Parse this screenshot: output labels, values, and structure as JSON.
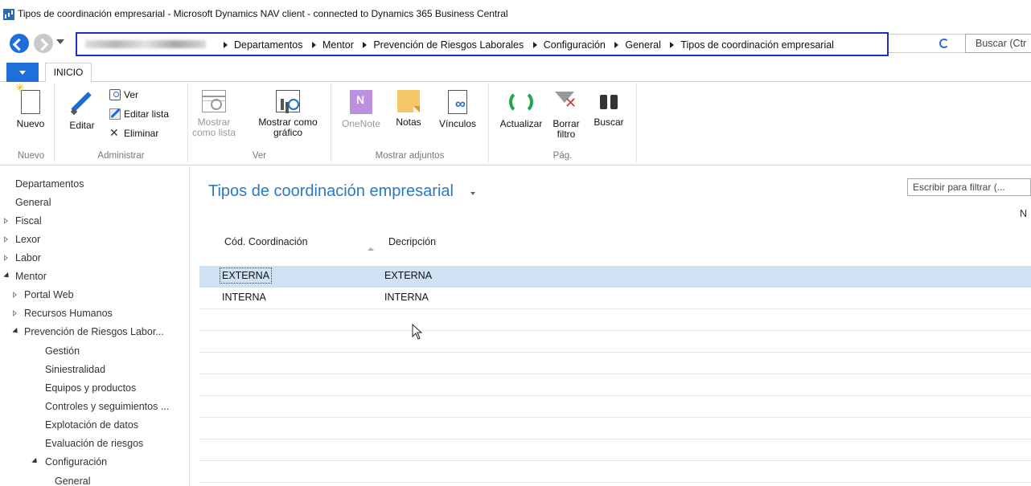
{
  "window": {
    "title": "Tipos de coordinación empresarial - Microsoft Dynamics NAV client - connected to Dynamics 365 Business Central"
  },
  "address": {
    "breadcrumb": [
      "Departamentos",
      "Mentor",
      "Prevención de Riesgos Laborales",
      "Configuración",
      "General",
      "Tipos de coordinación empresarial"
    ],
    "search_placeholder": "Buscar (Ctr"
  },
  "ribbon": {
    "tab": "INICIO",
    "groups": {
      "nuevo": {
        "label": "Nuevo",
        "buttons": {
          "nuevo": "Nuevo"
        }
      },
      "administrar": {
        "label": "Administrar",
        "buttons": {
          "editar": "Editar",
          "ver": "Ver",
          "editar_lista": "Editar lista",
          "eliminar": "Eliminar"
        }
      },
      "ver": {
        "label": "Ver",
        "buttons": {
          "mostrar_lista_1": "Mostrar",
          "mostrar_lista_2": "como lista",
          "mostrar_grafico_1": "Mostrar como",
          "mostrar_grafico_2": "gráfico"
        }
      },
      "adjuntos": {
        "label": "Mostrar adjuntos",
        "buttons": {
          "onenote": "OneNote",
          "notas": "Notas",
          "vinculos": "Vínculos"
        }
      },
      "pag": {
        "label": "Pág.",
        "buttons": {
          "actualizar": "Actualizar",
          "borrar_filtro_1": "Borrar",
          "borrar_filtro_2": "filtro",
          "buscar": "Buscar"
        }
      }
    }
  },
  "sidebar": {
    "items": [
      {
        "label": "Departamentos",
        "level": 0,
        "expander": "none"
      },
      {
        "label": "General",
        "level": 0,
        "expander": "none"
      },
      {
        "label": "Fiscal",
        "level": 0,
        "expander": "collapsed"
      },
      {
        "label": "Lexor",
        "level": 0,
        "expander": "collapsed"
      },
      {
        "label": "Labor",
        "level": 0,
        "expander": "collapsed"
      },
      {
        "label": "Mentor",
        "level": 0,
        "expander": "expanded"
      },
      {
        "label": "Portal Web",
        "level": 1,
        "expander": "collapsed"
      },
      {
        "label": "Recursos Humanos",
        "level": 1,
        "expander": "collapsed"
      },
      {
        "label": "Prevención de Riesgos Labor...",
        "level": 1,
        "expander": "expanded"
      },
      {
        "label": "Gestión",
        "level": 2,
        "expander": "none"
      },
      {
        "label": "Siniestralidad",
        "level": 2,
        "expander": "none"
      },
      {
        "label": "Equipos y productos",
        "level": 2,
        "expander": "none"
      },
      {
        "label": "Controles y seguimientos ...",
        "level": 2,
        "expander": "none"
      },
      {
        "label": "Explotación de datos",
        "level": 2,
        "expander": "none"
      },
      {
        "label": "Evaluación de riesgos",
        "level": 2,
        "expander": "none"
      },
      {
        "label": "Configuración",
        "level": 2,
        "expander": "expanded"
      },
      {
        "label": "General",
        "level": 3,
        "expander": "none"
      }
    ]
  },
  "main": {
    "title": "Tipos de coordinación empresarial",
    "filter_placeholder": "Escribir para filtrar (...",
    "right_label": "N",
    "columns": [
      "Cód. Coordinación",
      "Decripción"
    ],
    "rows": [
      {
        "code": "EXTERNA",
        "description": "EXTERNA",
        "selected": true
      },
      {
        "code": "INTERNA",
        "description": "INTERNA",
        "selected": false
      }
    ]
  },
  "colors": {
    "accent": "#1e6fd9",
    "title_blue": "#2a78c7",
    "selection": "#cfe2f3",
    "address_border": "#1c2fbf"
  }
}
